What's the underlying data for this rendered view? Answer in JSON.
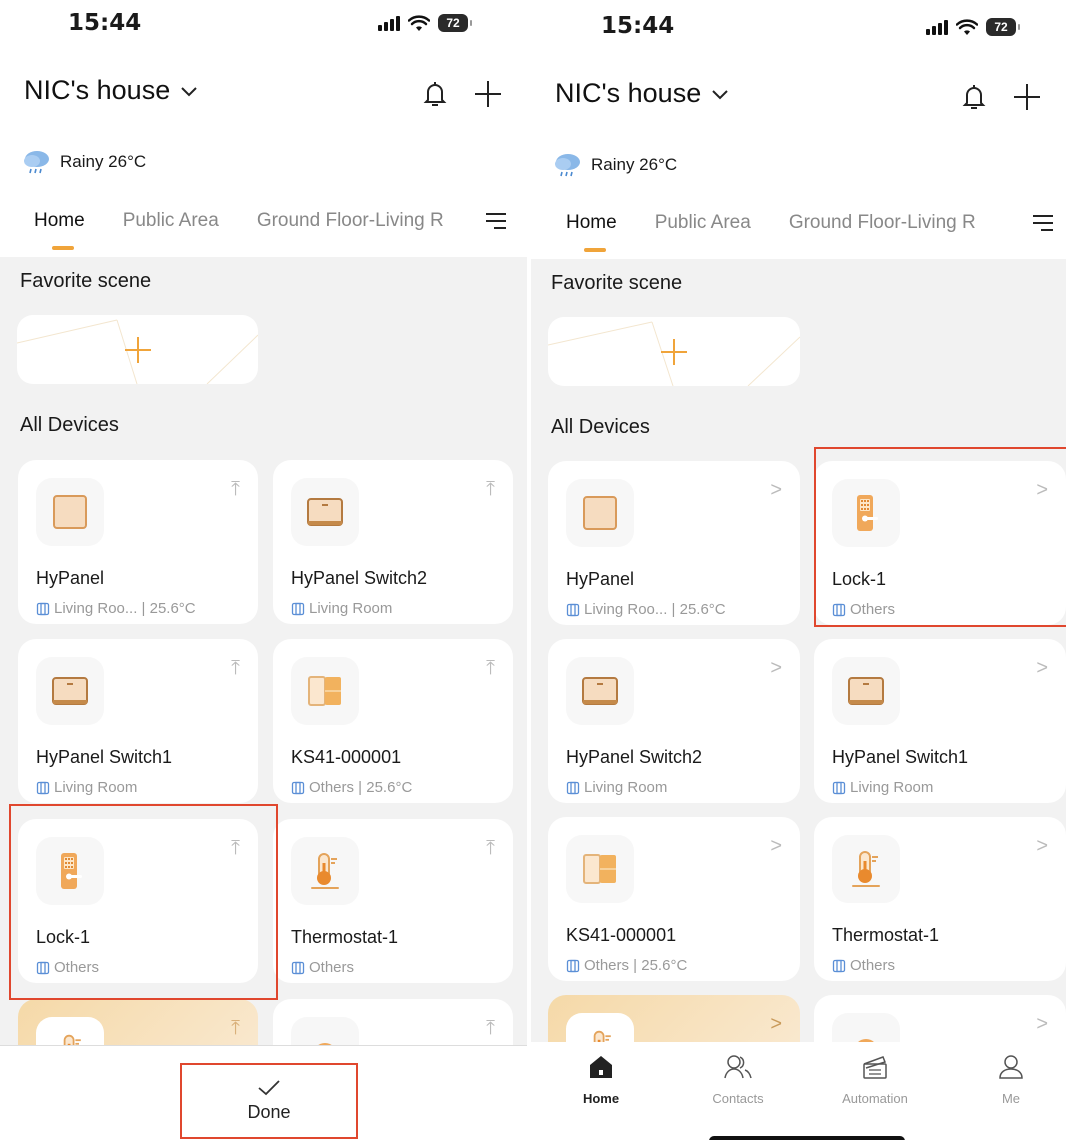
{
  "status": {
    "time": "15:44",
    "battery": "72"
  },
  "header": {
    "house_name": "NIC's house"
  },
  "weather": {
    "text": "Rainy 26°C"
  },
  "tabs": [
    "Home",
    "Public Area",
    "Ground Floor-Living R"
  ],
  "sections": {
    "favorite": "Favorite scene",
    "devices": "All Devices"
  },
  "left": {
    "devices": [
      {
        "name": "HyPanel",
        "sub": "Living Roo... | 25.6°C"
      },
      {
        "name": "HyPanel Switch2",
        "sub": "Living Room"
      },
      {
        "name": "HyPanel Switch1",
        "sub": "Living Room"
      },
      {
        "name": "KS41-000001",
        "sub": "Others | 25.6°C"
      },
      {
        "name": "Lock-1",
        "sub": "Others"
      },
      {
        "name": "Thermostat-1",
        "sub": "Others"
      }
    ],
    "done_label": "Done"
  },
  "right": {
    "devices": [
      {
        "name": "HyPanel",
        "sub": "Living Roo... | 25.6°C"
      },
      {
        "name": "Lock-1",
        "sub": "Others"
      },
      {
        "name": "HyPanel Switch2",
        "sub": "Living Room"
      },
      {
        "name": "HyPanel Switch1",
        "sub": "Living Room"
      },
      {
        "name": "KS41-000001",
        "sub": "Others | 25.6°C"
      },
      {
        "name": "Thermostat-1",
        "sub": "Others"
      }
    ],
    "tabbar": [
      "Home",
      "Contacts",
      "Automation",
      "Me"
    ]
  },
  "colors": {
    "accent": "#f0a43a",
    "highlight_box": "#e0472e",
    "background": "#f2f2f2"
  }
}
